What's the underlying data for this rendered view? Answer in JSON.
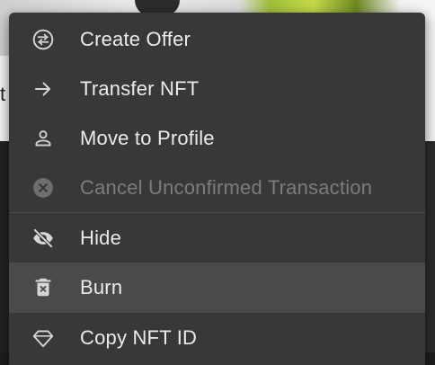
{
  "background": {
    "strip_text": "t"
  },
  "menu": {
    "items": [
      {
        "label": "Create Offer",
        "icon": "swap-icon",
        "disabled": false
      },
      {
        "label": "Transfer NFT",
        "icon": "arrow-right-icon",
        "disabled": false
      },
      {
        "label": "Move to Profile",
        "icon": "person-icon",
        "disabled": false
      },
      {
        "label": "Cancel Unconfirmed Transaction",
        "icon": "cancel-circle-icon",
        "disabled": true
      },
      {
        "label": "Hide",
        "icon": "eye-off-icon",
        "disabled": false
      },
      {
        "label": "Burn",
        "icon": "delete-forever-icon",
        "disabled": false,
        "hovered": true
      },
      {
        "label": "Copy NFT ID",
        "icon": "diamond-icon",
        "disabled": false
      }
    ]
  },
  "colors": {
    "menu_bg": "#383838",
    "hover_bg": "#4a4a4a",
    "text": "#ebebeb",
    "disabled_text": "#7c7c7c",
    "icon": "#d6d6d6"
  }
}
